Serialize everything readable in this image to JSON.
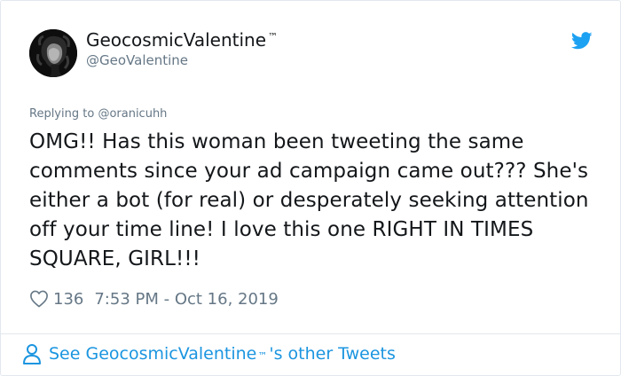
{
  "author": {
    "display_name": "GeocosmicValentine",
    "trademark": "™",
    "handle": "@GeoValentine"
  },
  "reply": {
    "prefix": "Replying to",
    "handle": "@oranicuhh"
  },
  "tweet": {
    "text": "OMG!! Has this woman been tweeting the same comments since your ad campaign came out??? She's either a bot (for real) or desperately seeking attention off your time line! I love this one RIGHT IN TIMES SQUARE, GIRL!!!"
  },
  "meta": {
    "likes": "136",
    "timestamp": "7:53 PM - Oct 16, 2019"
  },
  "footer": {
    "prefix": "See GeocosmicValentine",
    "trademark": "™",
    "suffix": "'s other Tweets"
  },
  "icons": {
    "platform": "twitter-bird-icon",
    "like": "heart-icon",
    "profile": "person-icon"
  },
  "colors": {
    "brand_blue": "#1da1f2",
    "link_blue": "#1b95e0",
    "secondary_text": "#657786",
    "primary_text": "#14171a",
    "border": "#e1e8ed"
  }
}
